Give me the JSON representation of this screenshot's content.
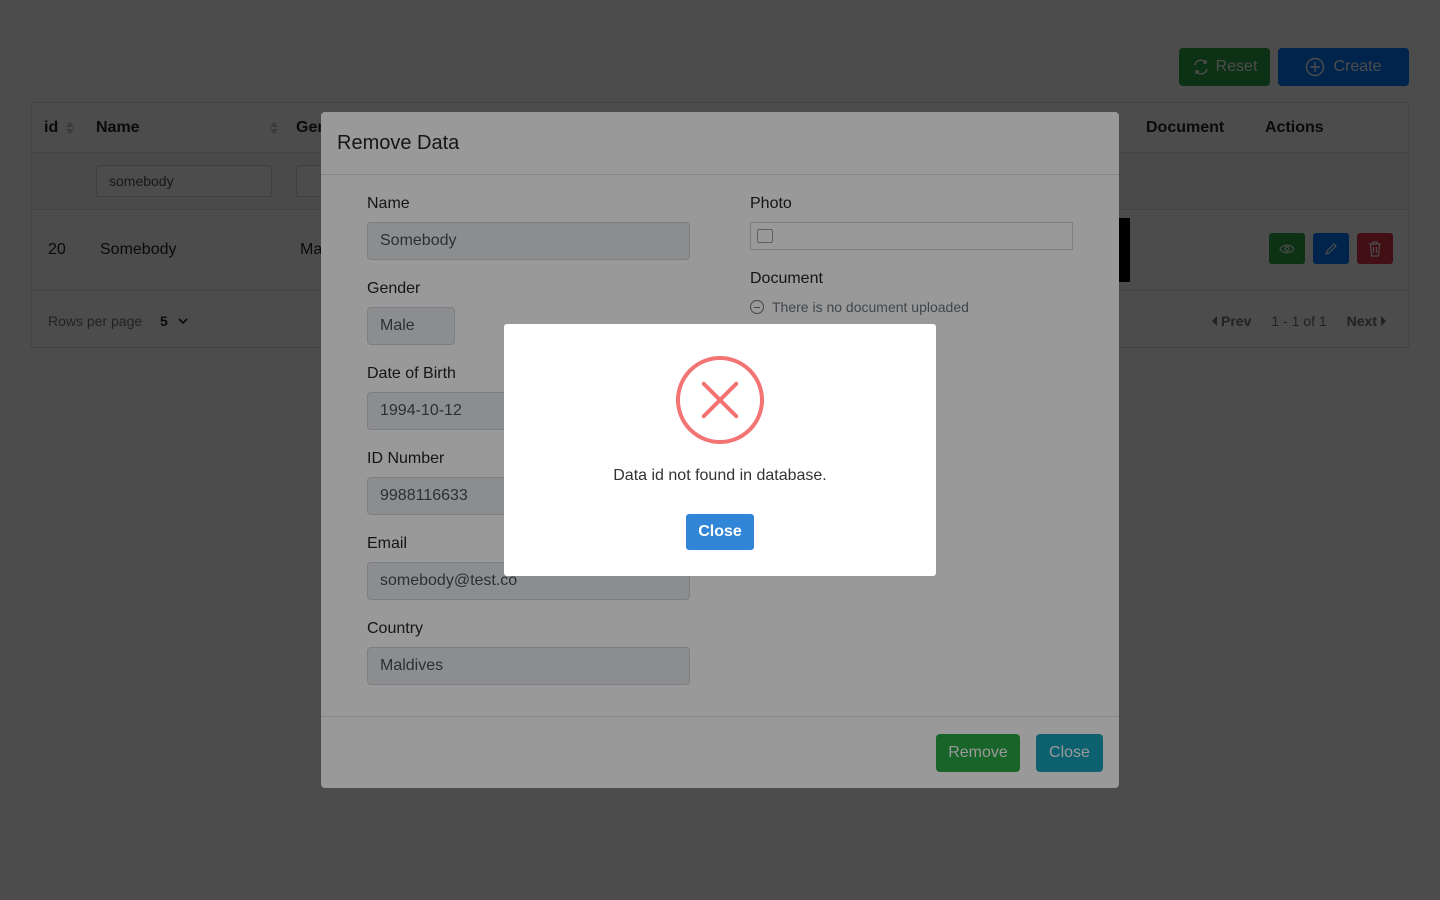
{
  "toolbar": {
    "reset_label": "Reset",
    "create_label": "Create"
  },
  "table": {
    "headers": [
      "id",
      "Name",
      "Gender",
      "Document",
      "Actions"
    ],
    "filters": {
      "name_value": "somebody"
    },
    "row": {
      "id": "20",
      "name": "Somebody",
      "gender": "Male"
    },
    "rows_per_page_label": "Rows per page",
    "rows_per_page_value": "5",
    "prev_label": "Prev",
    "range_label": "1 - 1 of 1",
    "next_label": "Next"
  },
  "modal": {
    "title": "Remove Data",
    "fields": {
      "name_label": "Name",
      "name_value": "Somebody",
      "gender_label": "Gender",
      "gender_value": "Male",
      "dob_label": "Date of Birth",
      "dob_value": "1994-10-12",
      "idnum_label": "ID Number",
      "idnum_value": "9988116633",
      "email_label": "Email",
      "email_value": "somebody@test.co",
      "country_label": "Country",
      "country_value": "Maldives",
      "photo_label": "Photo",
      "document_label": "Document",
      "document_status": "There is no document uploaded"
    },
    "remove_label": "Remove",
    "close_label": "Close"
  },
  "alert": {
    "icon": "error-x-icon",
    "message": "Data id not found in database.",
    "close_label": "Close"
  }
}
